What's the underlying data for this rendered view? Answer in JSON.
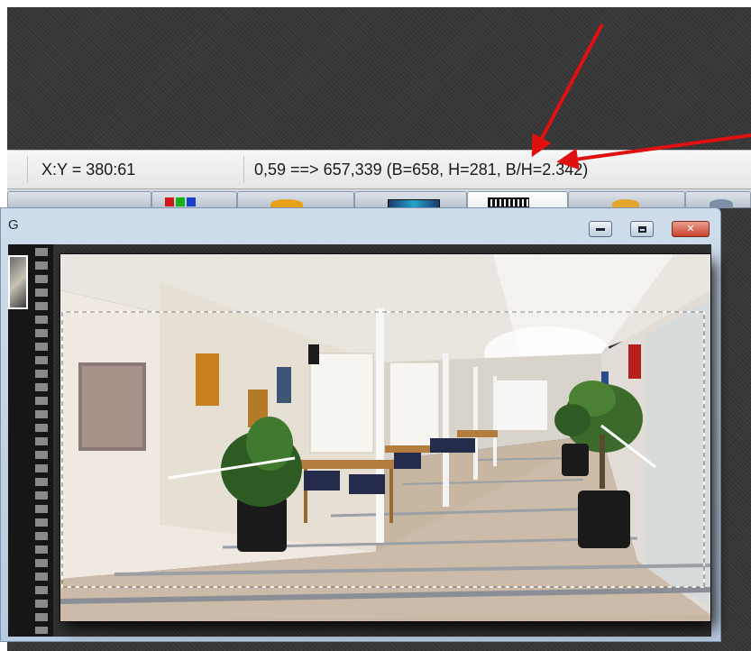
{
  "statusbar": {
    "coords": "X:Y = 380:61",
    "selection": "0,59 ==> 657,339 (B=658, H=281, B/H=2.342)"
  },
  "window": {
    "title_fragment": "G",
    "minimize_icon": "minimize-icon",
    "maximize_icon": "maximize-icon",
    "close_icon": "close-icon"
  },
  "colors": {
    "annotation_arrow": "#e01010",
    "window_frame": "#b8cadf",
    "close_button": "#c7422a"
  },
  "photo": {
    "subject": "hallway-photo",
    "selection_marquee": "dashed-crop-rectangle"
  }
}
